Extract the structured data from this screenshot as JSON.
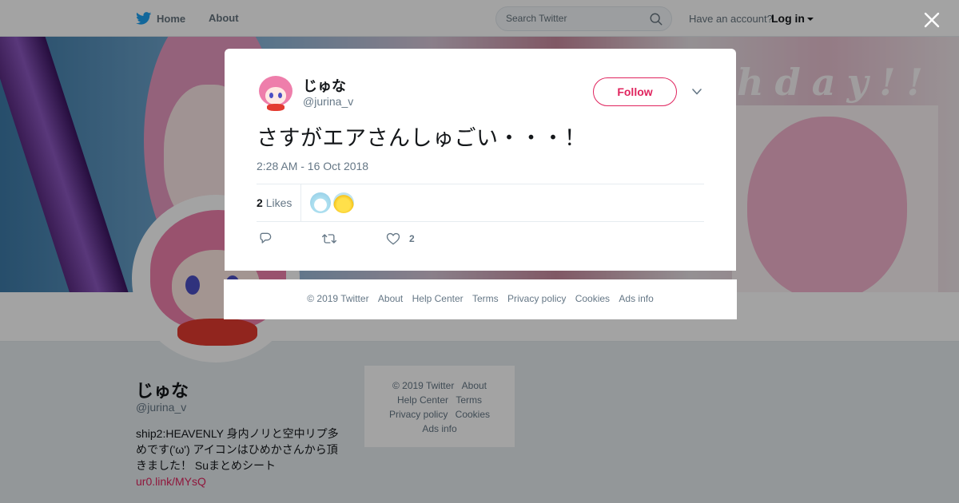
{
  "topbar": {
    "home_label": "Home",
    "about_label": "About",
    "search_placeholder": "Search Twitter",
    "account_question": "Have an account?",
    "login_label": "Log in"
  },
  "banner": {
    "text": "happy Birthday!!"
  },
  "profile": {
    "display_name": "じゅな",
    "handle": "@jurina_v",
    "bio_text": "ship2:HEAVENLY 身内ノリと空中リプ多めです('ω') アイコンはひめかさんから頂きました！ Suまとめシート",
    "bio_link": "ur0.link/MYsQ"
  },
  "side_footer": {
    "copyright": "© 2019 Twitter",
    "about": "About",
    "help": "Help Center",
    "terms": "Terms",
    "privacy": "Privacy policy",
    "cookies": "Cookies",
    "ads": "Ads info"
  },
  "tweet": {
    "name": "じゅな",
    "handle": "@jurina_v",
    "follow_label": "Follow",
    "text": "さすがエアさんしゅごい・・・！",
    "timestamp": "2:28 AM - 16 Oct 2018",
    "likes_number": "2",
    "likes_label": "Likes",
    "like_action_count": "2"
  },
  "modal_footer": {
    "copyright": "© 2019 Twitter",
    "about": "About",
    "help": "Help Center",
    "terms": "Terms",
    "privacy": "Privacy policy",
    "cookies": "Cookies",
    "ads": "Ads info"
  },
  "colors": {
    "accent": "#e0245e",
    "twitter_blue": "#1da1f2",
    "text_secondary": "#657786"
  },
  "icons": [
    "twitter-bird-icon",
    "search-icon",
    "caret-down-icon",
    "close-icon",
    "reply-icon",
    "retweet-icon",
    "heart-icon"
  ]
}
